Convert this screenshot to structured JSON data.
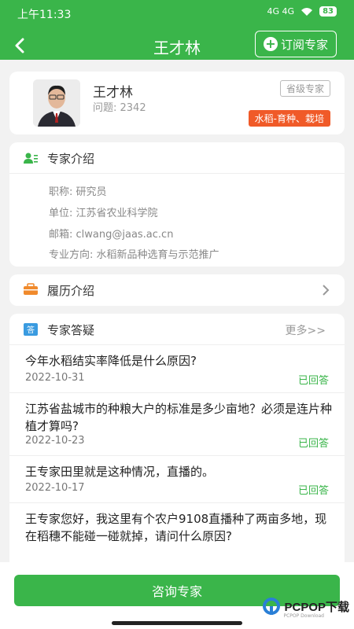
{
  "status_bar": {
    "time": "上午11:33",
    "battery": "83",
    "network": "4G 4G"
  },
  "header": {
    "title": "王才林",
    "subscribe_label": "订阅专家"
  },
  "profile": {
    "name": "王才林",
    "questions": "问题: 2342",
    "level": "省级专家",
    "tag": "水稻-育种、栽培"
  },
  "intro": {
    "title": "专家介绍",
    "rows": [
      "职称: 研究员",
      "单位: 江苏省农业科学院",
      "邮箱: clwang@jaas.ac.cn",
      "专业方向: 水稻新品种选育与示范推广"
    ]
  },
  "resume": {
    "title": "履历介绍"
  },
  "qa": {
    "title": "专家答疑",
    "more": "更多>>",
    "items": [
      {
        "question": "今年水稻结实率降低是什么原因?",
        "date": "2022-10-31",
        "status": "已回答"
      },
      {
        "question": "江苏省盐城市的种粮大户的标准是多少亩地？必须是连片种植才算吗?",
        "date": "2022-10-23",
        "status": "已回答"
      },
      {
        "question": "王专家田里就是这种情况，直播的。",
        "date": "2022-10-17",
        "status": "已回答"
      },
      {
        "question": "王专家您好，我这里有个农户9108直播种了两亩多地，现在稻穗不能碰一碰就掉，请问什么原因?",
        "date": "",
        "status": ""
      }
    ]
  },
  "bottom": {
    "consult_label": "咨询专家"
  },
  "watermark": {
    "text": "PCPOP下载",
    "sub": "PCPOP Download"
  },
  "colors": {
    "primary": "#3ab54a",
    "tag": "#f05a28"
  }
}
